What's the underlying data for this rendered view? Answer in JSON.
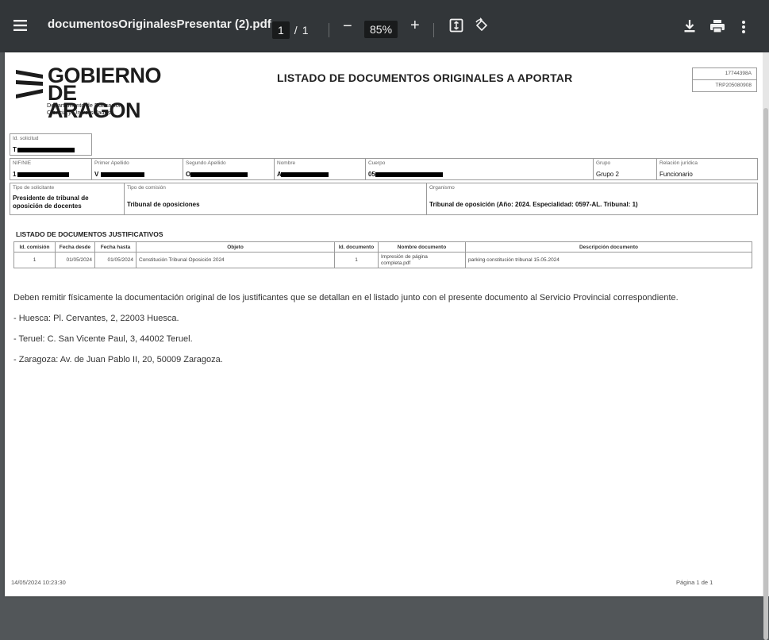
{
  "viewer": {
    "filename": "documentosOriginalesPresentar (2).pdf",
    "current_page": "1",
    "page_separator": "/",
    "total_pages": "1",
    "zoom_out": "−",
    "zoom": "85%",
    "zoom_in": "+"
  },
  "logo": {
    "line1": "GOBIERNO",
    "line2": "DE ARAGON",
    "dept1": "Departamento de Educación,",
    "dept2": "Ciencia y Universidades"
  },
  "document": {
    "title": "LISTADO DE DOCUMENTOS ORIGINALES A APORTAR",
    "ref1": "17744398A",
    "ref2": "TRP205080908"
  },
  "form": {
    "id_solicitud_label": "Id. solicitud",
    "id_solicitud_value": "T",
    "nif_label": "NIF/NIE",
    "nif_value": "1",
    "primer_apellido_label": "Primer Apellido",
    "primer_apellido_value": "V",
    "segundo_apellido_label": "Segundo Apellido",
    "segundo_apellido_value": "O",
    "nombre_label": "Nombre",
    "nombre_value": "A",
    "cuerpo_label": "Cuerpo",
    "cuerpo_value": "05",
    "grupo_label": "Grupo",
    "grupo_value": "Grupo 2",
    "relacion_label": "Relación jurídica",
    "relacion_value": "Funcionario",
    "tipo_solicitante_label": "Tipo de solicitante",
    "tipo_solicitante_value_1": "Presidente de tribunal de",
    "tipo_solicitante_value_2": "oposición de docentes",
    "tipo_comision_label": "Tipo de comisión",
    "tipo_comision_value": "Tribunal de oposiciones",
    "organismo_label": "Organismo",
    "organismo_value": "Tribunal de oposición (Año: 2024. Especialidad: 0597-AL. Tribunal: 1)"
  },
  "justificativos": {
    "section_title": "LISTADO DE DOCUMENTOS JUSTIFICATIVOS",
    "headers": [
      "Id. comisión",
      "Fecha desde",
      "Fecha hasta",
      "Objeto",
      "Id. documento",
      "Nombre documento",
      "Descripción documento"
    ],
    "rows": [
      {
        "id_comision": "1",
        "fecha_desde": "01/05/2024",
        "fecha_hasta": "01/05/2024",
        "objeto": "Constitución Tribunal Oposición 2024",
        "id_documento": "1",
        "nombre_documento_1": "Impresión de página",
        "nombre_documento_2": "completa.pdf",
        "descripcion": "parking constitución tribunal 15.05.2024"
      }
    ]
  },
  "notes": {
    "main": "Deben remitir físicamente la documentación original de los justificantes que se detallan en el listado junto con el presente documento al Servicio Provincial correspondiente.",
    "huesca": "- Huesca: Pl. Cervantes, 2, 22003 Huesca.",
    "teruel": "- Teruel: C. San Vicente Paul, 3, 44002 Teruel.",
    "zaragoza": "- Zaragoza: Av. de Juan Pablo II, 20, 50009 Zaragoza."
  },
  "footer": {
    "timestamp": "14/05/2024 10:23:30",
    "page_label": "Página 1 de 1"
  }
}
